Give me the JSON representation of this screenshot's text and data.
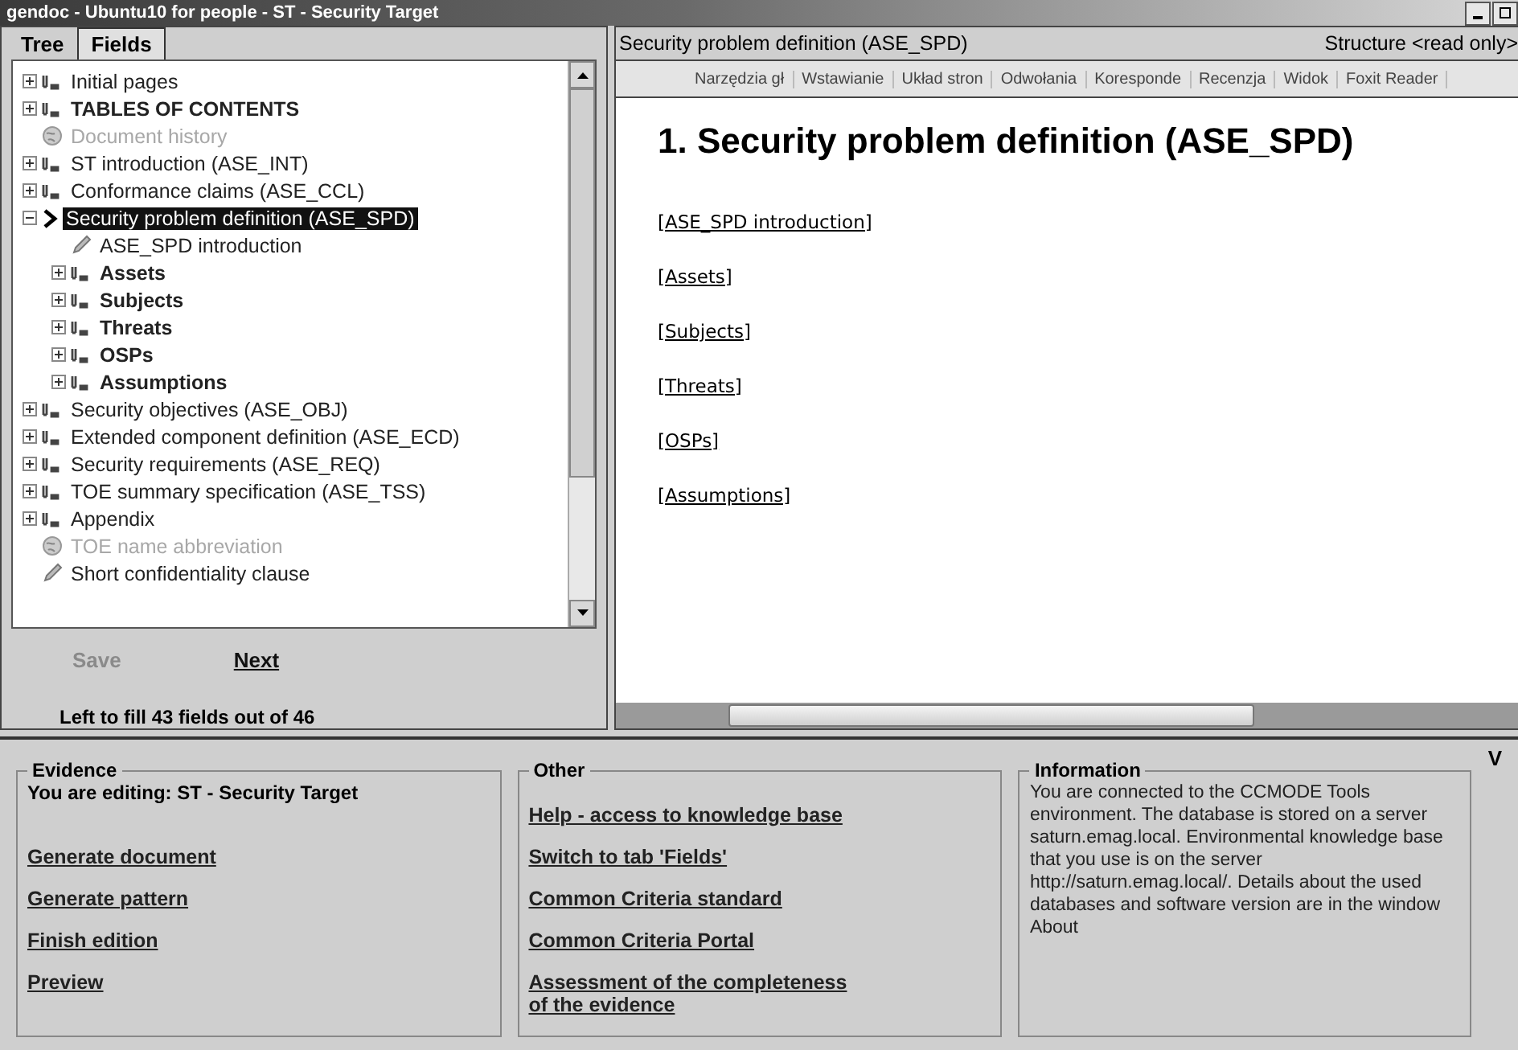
{
  "window": {
    "title": "gendoc - Ubuntu10 for people - ST - Security Target"
  },
  "left_tabs": [
    {
      "label": "Tree",
      "selected": true
    },
    {
      "label": "Fields",
      "selected": false
    }
  ],
  "tree": {
    "items": [
      {
        "label": "Initial pages",
        "kind": "section",
        "bold": false,
        "disabled": false,
        "selected": false,
        "expanded": false
      },
      {
        "label": "TABLES OF CONTENTS",
        "kind": "section",
        "bold": true,
        "disabled": false,
        "selected": false,
        "expanded": false
      },
      {
        "label": "Document history",
        "kind": "global",
        "bold": false,
        "disabled": true,
        "selected": false
      },
      {
        "label": "ST introduction (ASE_INT)",
        "kind": "section",
        "bold": false,
        "disabled": false,
        "selected": false,
        "expanded": false
      },
      {
        "label": "Conformance claims (ASE_CCL)",
        "kind": "section",
        "bold": false,
        "disabled": false,
        "selected": false,
        "expanded": false
      },
      {
        "label": "Security problem definition (ASE_SPD)",
        "kind": "section",
        "bold": false,
        "disabled": false,
        "selected": true,
        "expanded": true,
        "children": [
          {
            "label": "ASE_SPD introduction",
            "kind": "field",
            "bold": false,
            "disabled": false,
            "selected": false
          },
          {
            "label": "Assets",
            "kind": "section",
            "bold": true,
            "disabled": false,
            "selected": false,
            "expanded": false
          },
          {
            "label": "Subjects",
            "kind": "section",
            "bold": true,
            "disabled": false,
            "selected": false,
            "expanded": false
          },
          {
            "label": "Threats",
            "kind": "section",
            "bold": true,
            "disabled": false,
            "selected": false,
            "expanded": false
          },
          {
            "label": "OSPs",
            "kind": "section",
            "bold": true,
            "disabled": false,
            "selected": false,
            "expanded": false
          },
          {
            "label": "Assumptions",
            "kind": "section",
            "bold": true,
            "disabled": false,
            "selected": false,
            "expanded": false
          }
        ]
      },
      {
        "label": "Security objectives (ASE_OBJ)",
        "kind": "section",
        "bold": false,
        "disabled": false,
        "selected": false,
        "expanded": false
      },
      {
        "label": "Extended component definition (ASE_ECD)",
        "kind": "section",
        "bold": false,
        "disabled": false,
        "selected": false,
        "expanded": false
      },
      {
        "label": "Security requirements (ASE_REQ)",
        "kind": "section",
        "bold": false,
        "disabled": false,
        "selected": false,
        "expanded": false
      },
      {
        "label": "TOE summary specification (ASE_TSS)",
        "kind": "section",
        "bold": false,
        "disabled": false,
        "selected": false,
        "expanded": false
      },
      {
        "label": "Appendix",
        "kind": "section",
        "bold": false,
        "disabled": false,
        "selected": false,
        "expanded": false
      },
      {
        "label": "TOE name abbreviation",
        "kind": "global",
        "bold": false,
        "disabled": true,
        "selected": false
      },
      {
        "label": "Short confidentiality clause",
        "kind": "field",
        "bold": false,
        "disabled": false,
        "selected": false
      }
    ]
  },
  "actions": [
    {
      "label": "Save",
      "disabled": true
    },
    {
      "label": "Next",
      "disabled": false
    }
  ],
  "status": "Left to fill 43 fields out of 46",
  "document": {
    "title": "Security problem definition (ASE_SPD)",
    "mode": "Structure <read only>",
    "ribbon_tabs": [
      "Narzędzia gł",
      "Wstawianie",
      "Układ stron",
      "Odwołania",
      "Koresponde",
      "Recenzja",
      "Widok",
      "Foxit Reader"
    ],
    "heading": "1.  Security problem definition (ASE_SPD)",
    "links": [
      "[ASE_SPD introduction]",
      "[Assets]",
      "[Subjects]",
      "[Threats]",
      "[OSPs]",
      "[Assumptions]"
    ]
  },
  "evidence": {
    "title": "Evidence",
    "editing": "You are editing: ST - Security Target",
    "links": [
      "Generate document",
      "Generate pattern",
      "Finish edition",
      "Preview"
    ]
  },
  "other": {
    "title": "Other",
    "links": [
      "Help - access to knowledge base",
      "Switch to tab 'Fields'",
      "Common Criteria standard",
      "Common Criteria Portal",
      "Assessment of the completeness of the evidence"
    ]
  },
  "information": {
    "title": "Information",
    "text": "You are connected to the CCMODE Tools environment. The database is stored on a server saturn.emag.local. Environmental knowledge base that you use is on the server http://saturn.emag.local/. Details about the used databases and software version are in the window About"
  },
  "edge_label": "V"
}
